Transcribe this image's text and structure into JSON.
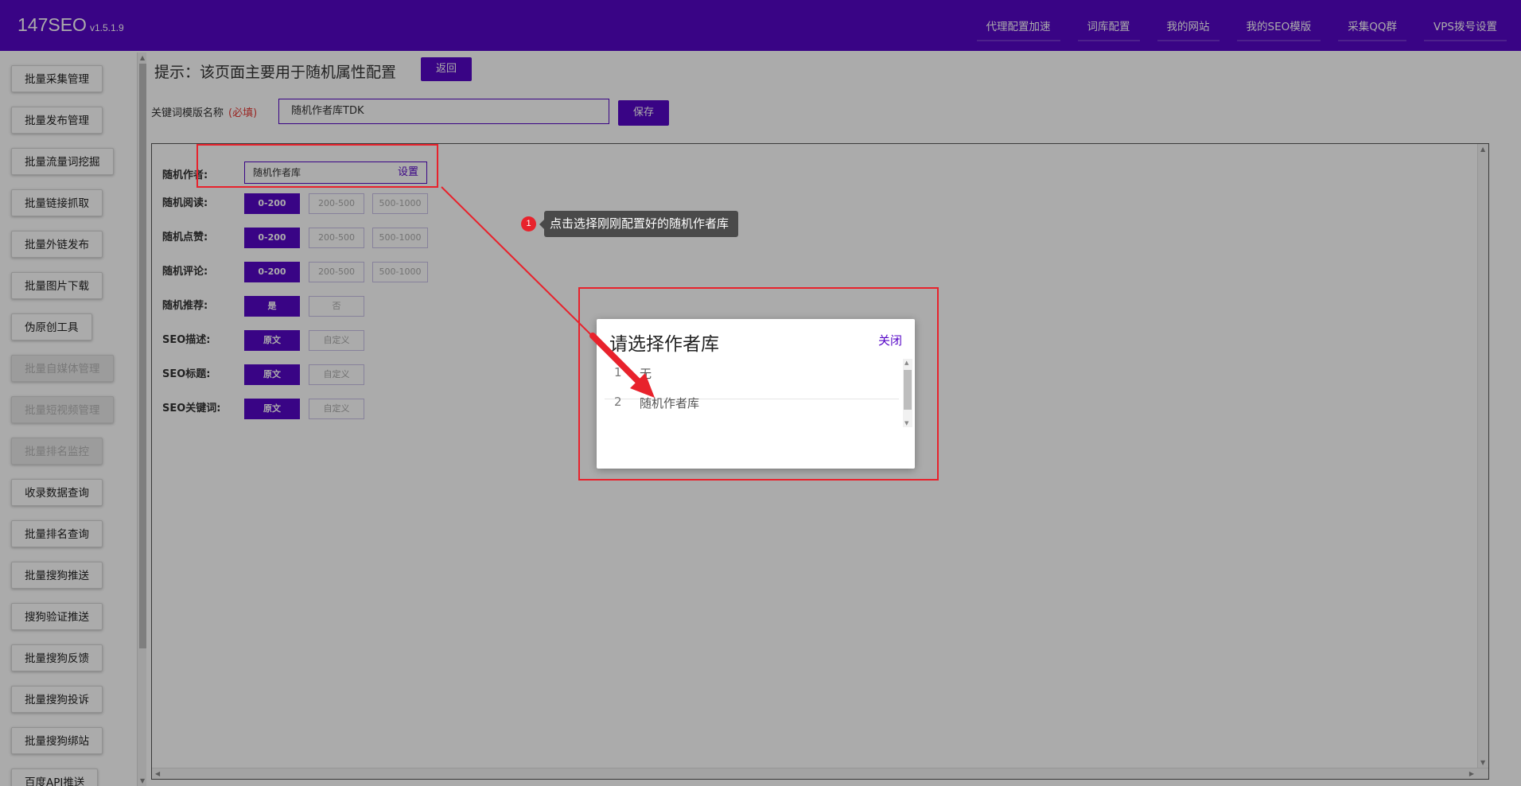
{
  "app": {
    "name": "147SEO",
    "version": "v1.5.1.9"
  },
  "topnav": [
    "代理配置加速",
    "词库配置",
    "我的网站",
    "我的SEO模版",
    "采集QQ群",
    "VPS拨号设置"
  ],
  "sidebar": {
    "items": [
      {
        "label": "批量采集管理",
        "disabled": false
      },
      {
        "label": "批量发布管理",
        "disabled": false
      },
      {
        "label": "批量流量词挖掘",
        "disabled": false
      },
      {
        "label": "批量链接抓取",
        "disabled": false
      },
      {
        "label": "批量外链发布",
        "disabled": false
      },
      {
        "label": "批量图片下载",
        "disabled": false
      },
      {
        "label": "伪原创工具",
        "disabled": false
      },
      {
        "label": "批量自媒体管理",
        "disabled": true
      },
      {
        "label": "批量短视频管理",
        "disabled": true
      },
      {
        "label": "批量排名监控",
        "disabled": true
      },
      {
        "label": "收录数据查询",
        "disabled": false
      },
      {
        "label": "批量排名查询",
        "disabled": false
      },
      {
        "label": "批量搜狗推送",
        "disabled": false
      },
      {
        "label": "搜狗验证推送",
        "disabled": false
      },
      {
        "label": "批量搜狗反馈",
        "disabled": false
      },
      {
        "label": "批量搜狗投诉",
        "disabled": false
      },
      {
        "label": "批量搜狗绑站",
        "disabled": false
      },
      {
        "label": "百度API推送",
        "disabled": false
      }
    ]
  },
  "main": {
    "tip": "提示：该页面主要用于随机属性配置",
    "back_label": "返回",
    "keyword_template_label": "关键词模版名称",
    "required_label": "(必填)",
    "keyword_template_value": "随机作者库TDK",
    "save_label": "保存"
  },
  "config": {
    "author": {
      "label": "随机作者:",
      "value": "随机作者库",
      "set_label": "设置"
    },
    "rows": [
      {
        "label": "随机阅读:",
        "options": [
          "0-200",
          "200-500",
          "500-1000"
        ]
      },
      {
        "label": "随机点赞:",
        "options": [
          "0-200",
          "200-500",
          "500-1000"
        ]
      },
      {
        "label": "随机评论:",
        "options": [
          "0-200",
          "200-500",
          "500-1000"
        ]
      },
      {
        "label": "随机推荐:",
        "options": [
          "是",
          "否"
        ]
      },
      {
        "label": "SEO描述:",
        "options": [
          "原文",
          "自定义"
        ]
      },
      {
        "label": "SEO标题:",
        "options": [
          "原文",
          "自定义"
        ]
      },
      {
        "label": "SEO关键词:",
        "options": [
          "原文",
          "自定义"
        ]
      }
    ]
  },
  "modal": {
    "title": "请选择作者库",
    "close_label": "关闭",
    "items": [
      {
        "index": "1",
        "label": "无"
      },
      {
        "index": "2",
        "label": "随机作者库"
      }
    ]
  },
  "annotation": {
    "step": "1",
    "text": "点击选择刚刚配置好的随机作者库"
  },
  "colors": {
    "accent": "#5606c7",
    "highlight": "#e8222c"
  }
}
